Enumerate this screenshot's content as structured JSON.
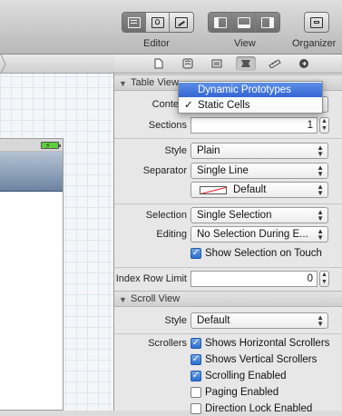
{
  "toolbar": {
    "editor_label": "Editor",
    "view_label": "View",
    "organizer_label": "Organizer",
    "editor_buttons": [
      "standard-editor-icon",
      "assistant-editor-icon",
      "version-editor-icon"
    ],
    "view_buttons": [
      "navigator-toggle-icon",
      "debug-area-toggle-icon",
      "utilities-toggle-icon"
    ],
    "organizer_icon": "organizer-icon"
  },
  "inspector_tabs": [
    "file-inspector-icon",
    "quick-help-icon",
    "identity-inspector-icon",
    "attributes-inspector-icon",
    "size-inspector-icon",
    "connections-inspector-icon"
  ],
  "table_view": {
    "header": "Table View",
    "content_label": "Conte",
    "sections_label": "Sections",
    "sections_value": "1",
    "style_label": "Style",
    "style_value": "Plain",
    "separator_label": "Separator",
    "separator_value": "Single Line",
    "separator_color_value": "Default",
    "selection_label": "Selection",
    "selection_value": "Single Selection",
    "editing_label": "Editing",
    "editing_value": "No Selection During E...",
    "show_selection_label": "Show Selection on Touch",
    "show_selection_checked": true,
    "index_row_limit_label": "Index Row Limit",
    "index_row_limit_value": "0"
  },
  "content_menu": {
    "items": [
      "Dynamic Prototypes",
      "Static Cells"
    ],
    "highlighted": "Dynamic Prototypes",
    "checked": "Static Cells",
    "check_mark": "✓"
  },
  "scroll_view": {
    "header": "Scroll View",
    "style_label": "Style",
    "style_value": "Default",
    "scrollers_label": "Scrollers",
    "options": [
      {
        "label": "Shows Horizontal Scrollers",
        "checked": true
      },
      {
        "label": "Shows Vertical Scrollers",
        "checked": true
      },
      {
        "label": "Scrolling Enabled",
        "checked": true
      },
      {
        "label": "Paging Enabled",
        "checked": false
      },
      {
        "label": "Direction Lock Enabled",
        "checked": false
      }
    ]
  },
  "colors": {
    "menu_highlight": "#3465d4",
    "checkbox_on": "#2a6fd0",
    "battery": "#5ccf3a",
    "navbar": "#6c84a1"
  }
}
